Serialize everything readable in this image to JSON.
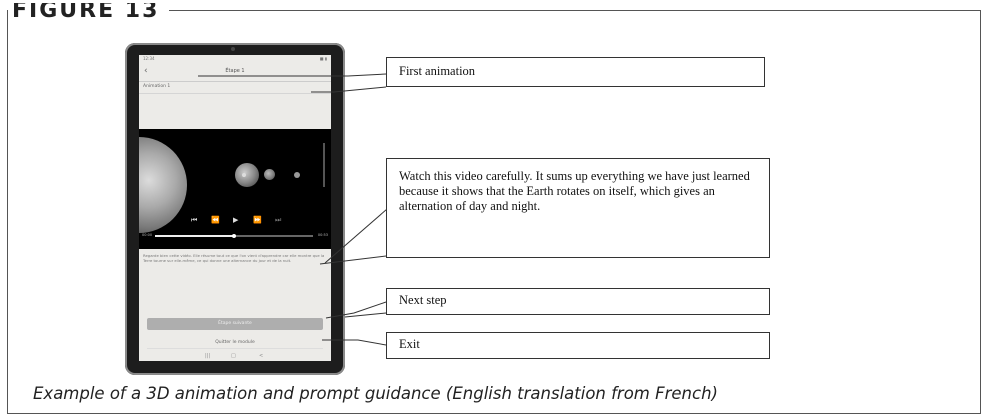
{
  "figure": {
    "label": "FIGURE 13",
    "caption": "Example of a 3D animation and prompt guidance (English translation from French)"
  },
  "tablet_app": {
    "status_time": "12:34",
    "status_icons": "■ ▮",
    "back_icon": "chevron-left-icon",
    "title": "Étape 1",
    "subheader": "Animation 1",
    "video": {
      "controls": [
        "skip-back-icon",
        "rewind-icon",
        "play-icon",
        "fast-forward-icon",
        "skip-forward-icon"
      ],
      "time_current": "00:00",
      "time_total": "00:53",
      "progress": 0.5
    },
    "body_text": "Regarde bien cette vidéo. Elle résume tout ce que l'on vient d'apprendre car elle montre que la Terre tourne sur elle-même, ce qui donne une alternance du jour et de la nuit.",
    "primary_button": "Étape suivante",
    "secondary_link": "Quitter le module",
    "nav_icons": [
      "recents-icon",
      "home-icon",
      "back-nav-icon"
    ]
  },
  "callouts": {
    "first": "First animation",
    "second": "Watch this video carefully. It sums up everything we have just learned because it shows that the Earth rotates on itself, which gives an alternation of day and night.",
    "third": "Next step",
    "fourth": "Exit"
  }
}
